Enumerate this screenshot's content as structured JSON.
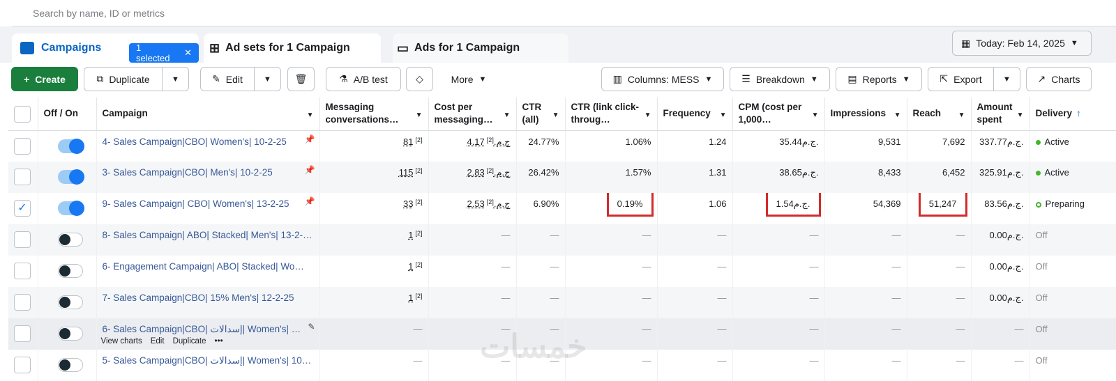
{
  "search": {
    "placeholder": "Search by name, ID or metrics"
  },
  "tabs": {
    "campaigns": "Campaigns",
    "selected": "1 selected",
    "adsets": "Ad sets for 1 Campaign",
    "ads": "Ads for 1 Campaign"
  },
  "date": "Today: Feb 14, 2025",
  "toolbar": {
    "create": "Create",
    "duplicate": "Duplicate",
    "edit": "Edit",
    "abtest": "A/B test",
    "more": "More",
    "columns": "Columns: MESS",
    "breakdown": "Breakdown",
    "reports": "Reports",
    "export": "Export",
    "charts": "Charts"
  },
  "headers": [
    "Off / On",
    "Campaign",
    "Messaging conversations…",
    "Cost per messaging…",
    "CTR (all)",
    "CTR (link click-throug…",
    "Frequency",
    "CPM (cost per 1,000…",
    "Impressions",
    "Reach",
    "Amount spent",
    "Delivery"
  ],
  "rows": [
    {
      "name": "4- Sales Campaign|CBO| Women's| 10-2-25",
      "msg": "81",
      "cpm_msg": "4.17ج.م.",
      "ctr": "24.77%",
      "ctrlink": "1.06%",
      "freq": "1.24",
      "cpm": "35.44ج.م.",
      "impr": "9,531",
      "reach": "7,692",
      "spent": "337.77ج.م.",
      "delivery": "Active"
    },
    {
      "name": "3- Sales Campaign|CBO| Men's| 10-2-25",
      "msg": "115",
      "cpm_msg": "2.83ج.م.",
      "ctr": "26.42%",
      "ctrlink": "1.57%",
      "freq": "1.31",
      "cpm": "38.65ج.م.",
      "impr": "8,433",
      "reach": "6,452",
      "spent": "325.91ج.م.",
      "delivery": "Active"
    },
    {
      "name": "9- Sales Campaign| CBO| Women's| 13-2-25",
      "msg": "33",
      "cpm_msg": "2.53ج.م.",
      "ctr": "6.90%",
      "ctrlink": "0.19%",
      "freq": "1.06",
      "cpm": "1.54ج.م.",
      "impr": "54,369",
      "reach": "51,247",
      "spent": "83.56ج.م.",
      "delivery": "Preparing"
    },
    {
      "name": "8- Sales Campaign| ABO| Stacked| Men's| 13-2-…",
      "msg": "1",
      "spent": "0.00ج.م.",
      "delivery": "Off"
    },
    {
      "name": "6- Engagement Campaign| ABO| Stacked| Wo…",
      "msg": "1",
      "spent": "0.00ج.م.",
      "delivery": "Off"
    },
    {
      "name": "7- Sales Campaign|CBO| 15% Men's| 12-2-25",
      "msg": "1",
      "spent": "0.00ج.م.",
      "delivery": "Off"
    },
    {
      "name": "6- Sales Campaign|CBO| إسدالات| Women's| …",
      "delivery": "Off"
    },
    {
      "name": "5- Sales Campaign|CBO| إسدالات| Women's| 10…",
      "delivery": "Off"
    }
  ],
  "rowactions": {
    "view": "View charts",
    "edit": "Edit",
    "duplicate": "Duplicate"
  },
  "dash": "—",
  "sup": "[2]",
  "watermark": "خمسات"
}
